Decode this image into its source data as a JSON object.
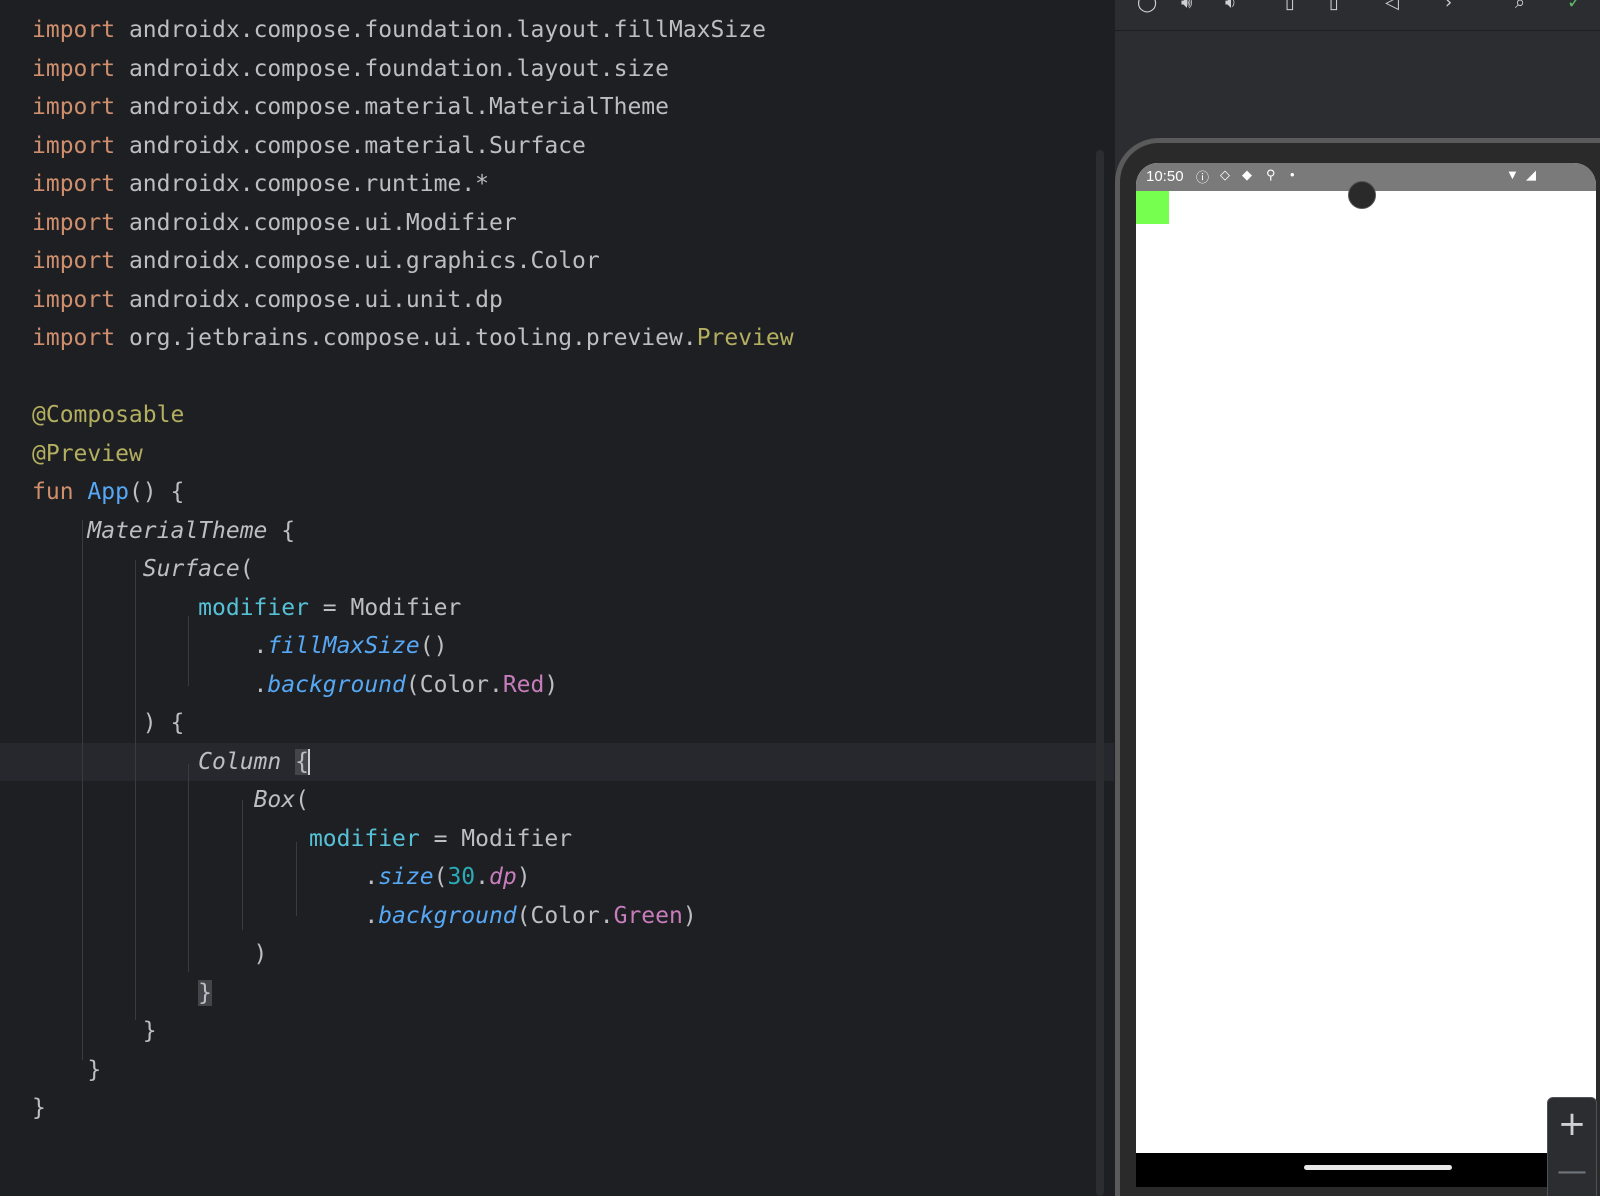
{
  "editor": {
    "lines": [
      [
        [
          "import",
          "kw"
        ],
        [
          " androidx.compose.foundation.layout.fillMaxSize",
          ""
        ]
      ],
      [
        [
          "import",
          "kw"
        ],
        [
          " androidx.compose.foundation.layout.size",
          ""
        ]
      ],
      [
        [
          "import",
          "kw"
        ],
        [
          " androidx.compose.material.MaterialTheme",
          ""
        ]
      ],
      [
        [
          "import",
          "kw"
        ],
        [
          " androidx.compose.material.Surface",
          ""
        ]
      ],
      [
        [
          "import",
          "kw"
        ],
        [
          " androidx.compose.runtime.*",
          ""
        ]
      ],
      [
        [
          "import",
          "kw"
        ],
        [
          " androidx.compose.ui.Modifier",
          ""
        ]
      ],
      [
        [
          "import",
          "kw"
        ],
        [
          " androidx.compose.ui.graphics.Color",
          ""
        ]
      ],
      [
        [
          "import",
          "kw"
        ],
        [
          " androidx.compose.ui.unit.dp",
          ""
        ]
      ],
      [
        [
          "import",
          "kw"
        ],
        [
          " org.jetbrains.compose.ui.tooling.preview.",
          ""
        ],
        [
          "Preview",
          "ann"
        ]
      ],
      [],
      [
        [
          "@Composable",
          "ann"
        ]
      ],
      [
        [
          "@Preview",
          "ann"
        ]
      ],
      [
        [
          "fun",
          "kw"
        ],
        [
          " ",
          ""
        ],
        [
          "App",
          "fn"
        ],
        [
          "() {",
          ""
        ]
      ],
      [
        [
          "    ",
          ""
        ],
        [
          "MaterialTheme",
          "call"
        ],
        [
          " {",
          ""
        ]
      ],
      [
        [
          "        ",
          ""
        ],
        [
          "Surface",
          "call"
        ],
        [
          "(",
          ""
        ]
      ],
      [
        [
          "            ",
          ""
        ],
        [
          "modifier",
          "param"
        ],
        [
          " = ",
          ""
        ],
        [
          "Modifier",
          ""
        ]
      ],
      [
        [
          "                .",
          ""
        ],
        [
          "fillMaxSize",
          "ext"
        ],
        [
          "()",
          ""
        ]
      ],
      [
        [
          "                .",
          ""
        ],
        [
          "background",
          "ext"
        ],
        [
          "(Color.",
          ""
        ],
        [
          "Red",
          "const"
        ],
        [
          ")",
          ""
        ]
      ],
      [
        [
          "        ) {",
          ""
        ]
      ],
      [
        [
          "            ",
          ""
        ],
        [
          "Column",
          "call"
        ],
        [
          " ",
          ""
        ],
        [
          "{",
          "brace-hl"
        ],
        [
          "",
          "caret"
        ]
      ],
      [
        [
          "                ",
          ""
        ],
        [
          "Box",
          "call"
        ],
        [
          "(",
          ""
        ]
      ],
      [
        [
          "                    ",
          ""
        ],
        [
          "modifier",
          "param"
        ],
        [
          " = ",
          ""
        ],
        [
          "Modifier",
          ""
        ]
      ],
      [
        [
          "                        .",
          ""
        ],
        [
          "size",
          "ext"
        ],
        [
          "(",
          ""
        ],
        [
          "30",
          "num"
        ],
        [
          ".",
          ""
        ],
        [
          "dp",
          "unit"
        ],
        [
          ")",
          ""
        ]
      ],
      [
        [
          "                        .",
          ""
        ],
        [
          "background",
          "ext"
        ],
        [
          "(Color.",
          ""
        ],
        [
          "Green",
          "const"
        ],
        [
          ")",
          ""
        ]
      ],
      [
        [
          "                )",
          ""
        ]
      ],
      [
        [
          "            ",
          ""
        ],
        [
          "}",
          "brace-hl"
        ]
      ],
      [
        [
          "        }",
          ""
        ]
      ],
      [
        [
          "    }",
          ""
        ]
      ],
      [
        [
          "}",
          ""
        ]
      ]
    ]
  },
  "preview": {
    "status_time": "10:50",
    "status_icons": [
      "info-icon",
      "shield-icon",
      "shield-filled-icon",
      "mic-icon",
      "dot-icon"
    ],
    "right_icons": [
      "wifi-icon",
      "signal-icon"
    ],
    "green_box_color": "#76ff4f",
    "zoom_in_label": "+",
    "zoom_out_label": "—"
  }
}
